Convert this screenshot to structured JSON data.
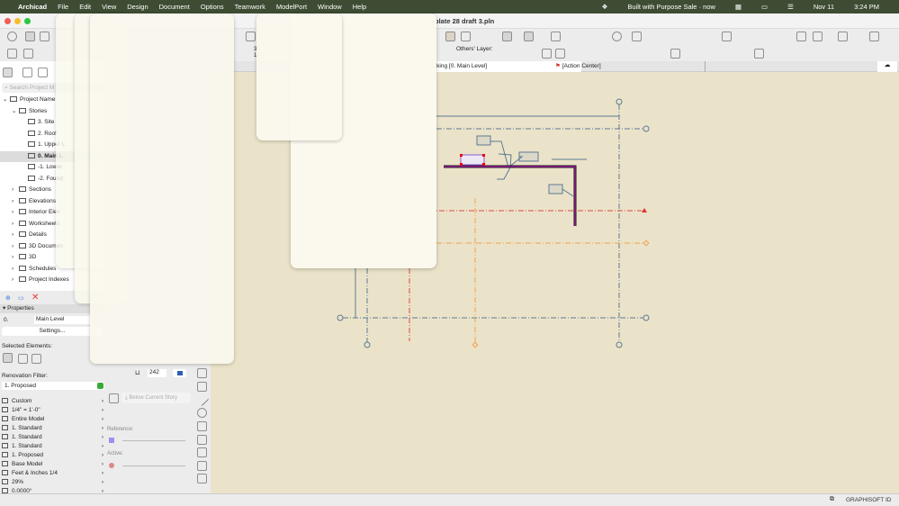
{
  "menubar": {
    "app": "Archicad",
    "items": [
      "File",
      "Edit",
      "View",
      "Design",
      "Document",
      "Options",
      "Teamwork",
      "ModelPort",
      "Window",
      "Help"
    ],
    "notification": "Built with Purpose Sale · now",
    "date": "Nov 11",
    "time": "3:24 PM"
  },
  "window": {
    "title": "plate 28 draft 3.pln"
  },
  "toolbar": {
    "others_layer_label": "Others' Layer:",
    "info_a": "32",
    "info_b": "18"
  },
  "tabs": [
    {
      "label": "rking [0. Main Level]"
    },
    {
      "label": "[Action Center]"
    }
  ],
  "navigator": {
    "search_placeholder": "Search Project M",
    "items": [
      {
        "label": "Project Name",
        "level": 0
      },
      {
        "label": "Stories",
        "level": 1
      },
      {
        "label": "3. Site",
        "level": 2
      },
      {
        "label": "2. Roof",
        "level": 2
      },
      {
        "label": "1. Upper L",
        "level": 2
      },
      {
        "label": "0. Main L",
        "level": 2,
        "selected": true
      },
      {
        "label": "-1. Lower",
        "level": 2
      },
      {
        "label": "-2. Found",
        "level": 2
      },
      {
        "label": "Sections",
        "level": 1
      },
      {
        "label": "Elevations",
        "level": 1
      },
      {
        "label": "Interior Elev",
        "level": 1
      },
      {
        "label": "Worksheets",
        "level": 1
      },
      {
        "label": "Details",
        "level": 1
      },
      {
        "label": "3D Documen",
        "level": 1
      },
      {
        "label": "3D",
        "level": 1
      },
      {
        "label": "Schedules",
        "level": 1
      },
      {
        "label": "Project Indexes",
        "level": 1
      }
    ]
  },
  "properties": {
    "header": "Properties",
    "story_num": "0.",
    "story_name": "Main Level",
    "settings": "Settings...",
    "selected_elements": "Selected Elements:",
    "renovation_filter_label": "Renovation Filter:",
    "renovation_filter_value": "1. Proposed",
    "quick_options": [
      "Custom",
      "1/4\"  =  1'-0\"",
      "Entire Model",
      "1. Standard",
      "1. Standard",
      "1. Standard",
      "1. Proposed",
      "Base Model",
      "Feet & Inches 1/4",
      "29%",
      "0.0000°"
    ]
  },
  "info_panel": {
    "value": "242",
    "below_story": "Below Current Story",
    "reference": "Reference:",
    "active": "Active:"
  },
  "status": {
    "brand": "GRAPHISOFT ID"
  },
  "colors": {
    "canvas": "#ebe3c9",
    "wall": "#8b1a8b",
    "grid": "#5c7a93",
    "red_line": "#d94a4a",
    "orange_line": "#f0a050",
    "menubar": "#3e4c33"
  }
}
